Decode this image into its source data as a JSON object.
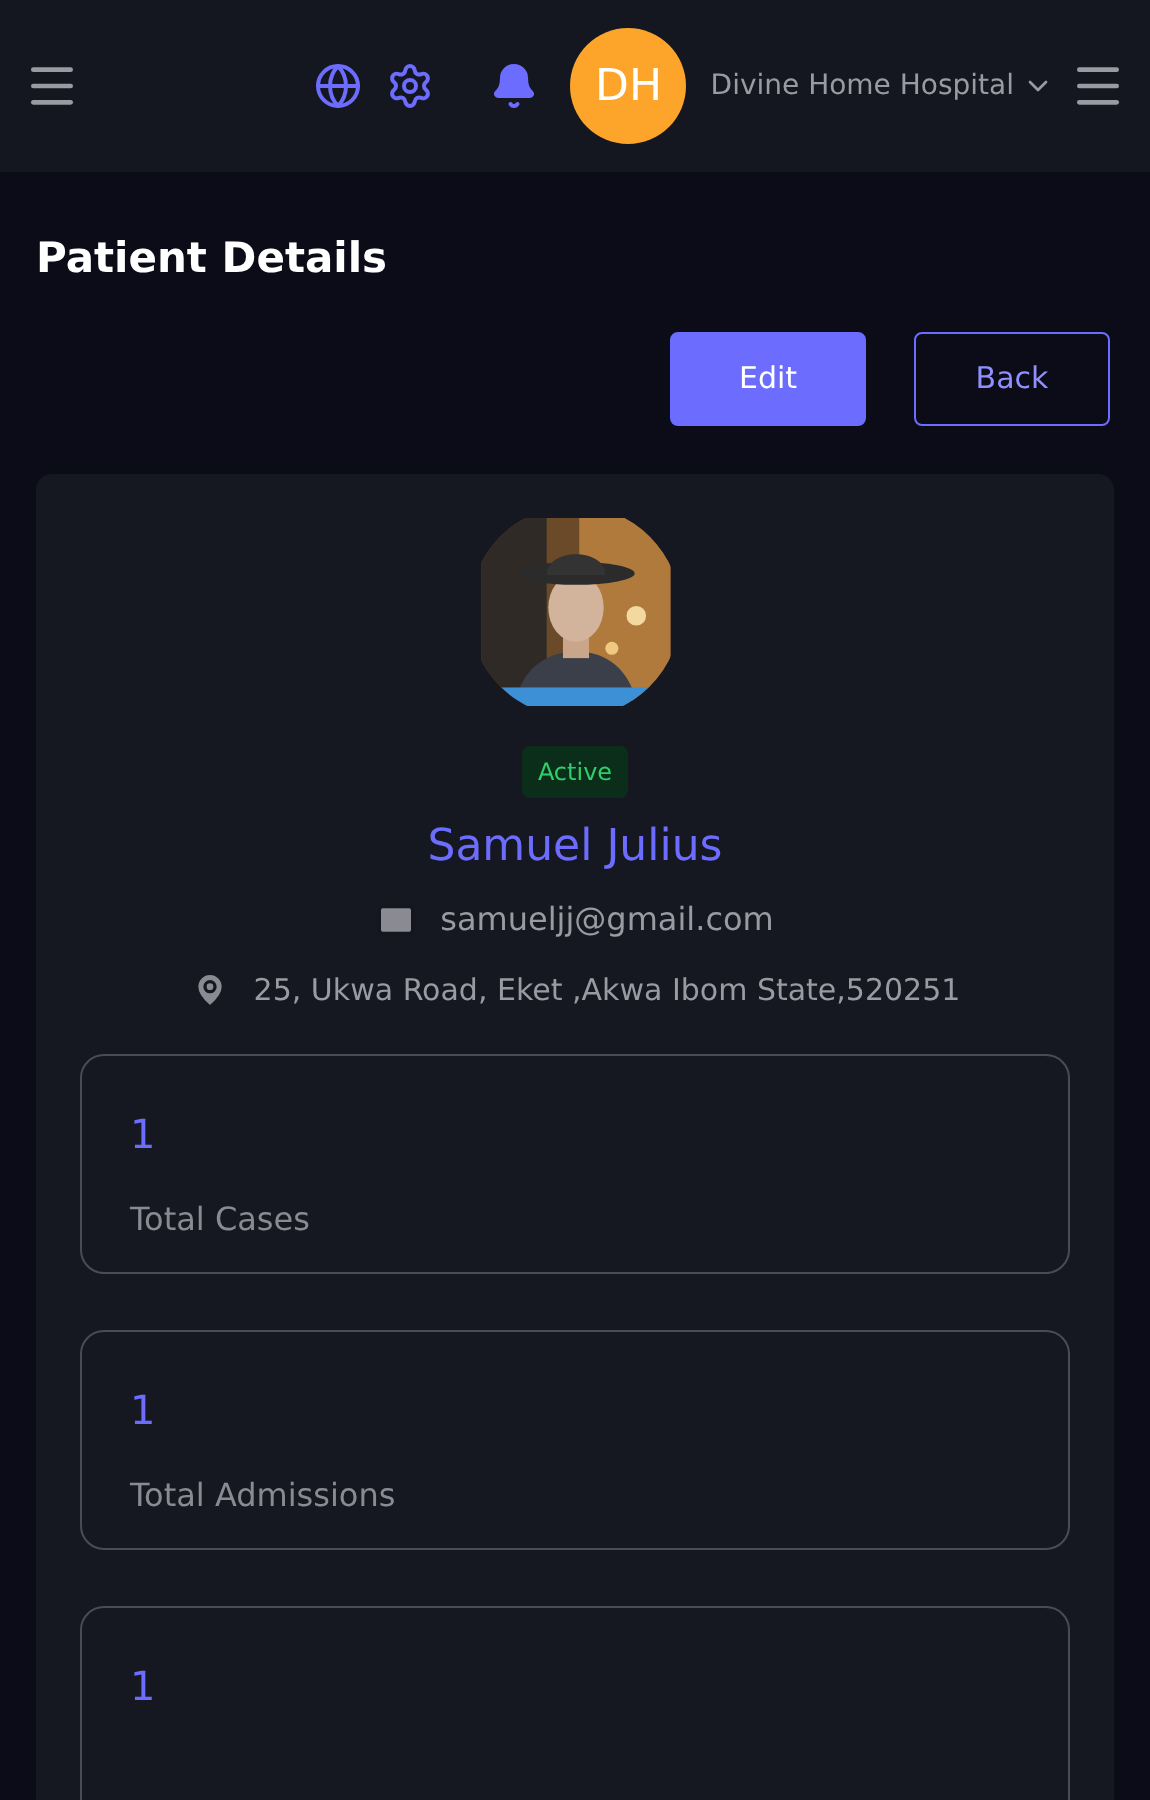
{
  "header": {
    "initials": "DH",
    "hospital_name": "Divine Home Hospital"
  },
  "page_title": "Patient Details",
  "actions": [
    {
      "label": "Edit",
      "kind": "primary"
    },
    {
      "label": "Back",
      "kind": "outline"
    }
  ],
  "patient": {
    "status": "Active",
    "name": "Samuel Julius",
    "email": "samueljj@gmail.com",
    "address": "25, Ukwa Road, Eket ,Akwa Ibom State,520251"
  },
  "stats": [
    {
      "value": "1",
      "label": "Total Cases"
    },
    {
      "value": "1",
      "label": "Total Admissions"
    },
    {
      "value": "1"
    }
  ]
}
